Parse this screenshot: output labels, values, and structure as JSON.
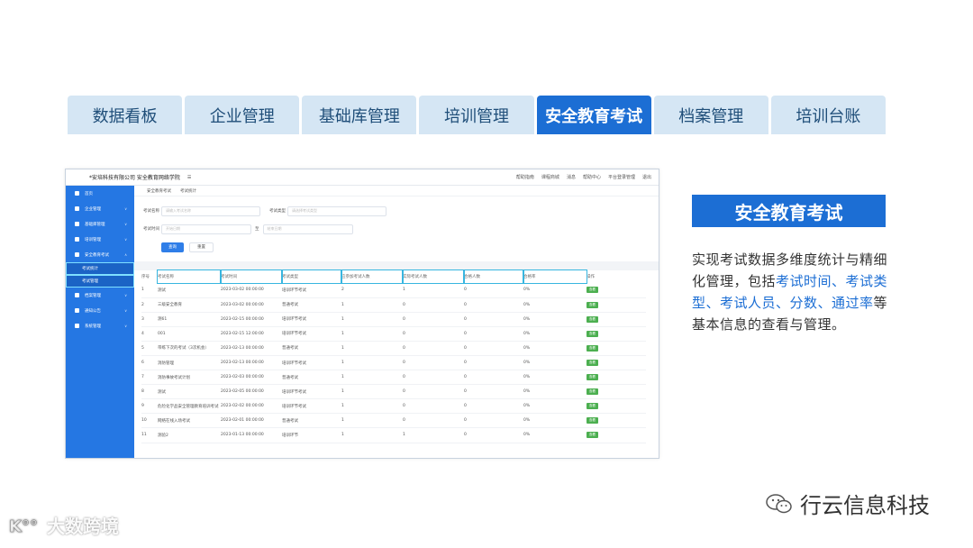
{
  "tabs": [
    "数据看板",
    "企业管理",
    "基础库管理",
    "培训管理",
    "安全教育考试",
    "档案管理",
    "培训台账"
  ],
  "active_tab_index": 4,
  "app": {
    "brand": "*安培科技有限公司 安全教育网络学院",
    "menu_icon": "menu-icon",
    "top_menu": [
      "帮助指南",
      "课程商城",
      "消息",
      "帮助中心",
      "平台登录管理",
      "退出"
    ]
  },
  "sidebar": {
    "items": [
      {
        "label": "首页",
        "icon": "home-icon"
      },
      {
        "label": "企业管理",
        "icon": "company-icon"
      },
      {
        "label": "基础库管理",
        "icon": "library-icon"
      },
      {
        "label": "培训管理",
        "icon": "training-icon"
      },
      {
        "label": "安全教育考试",
        "icon": "exam-icon"
      },
      {
        "label": "档案管理",
        "icon": "archive-icon"
      },
      {
        "label": "通知公告",
        "icon": "notice-icon"
      },
      {
        "label": "系统管理",
        "icon": "settings-icon"
      }
    ],
    "subitems": [
      "考试统计",
      "考试管理"
    ]
  },
  "crumb": [
    "安全教育考试",
    "考试统计"
  ],
  "form": {
    "exam_name_label": "考试名称",
    "exam_name_placeholder": "请输入考试名称",
    "exam_type_label": "考试类型",
    "exam_type_placeholder": "请选择考试类型",
    "exam_time_label": "考试时间",
    "start_placeholder": "开始日期",
    "to": "至",
    "end_placeholder": "结束日期",
    "search_btn": "查询",
    "reset_btn": "重置"
  },
  "table": {
    "headers": [
      "序号",
      "考试名称",
      "考试时间",
      "考试类型",
      "应参加考试人数",
      "实际考试人数",
      "合格人数",
      "合格率",
      "操作"
    ],
    "rows": [
      [
        "1",
        "测试",
        "2023-03-02 00:00:00",
        "培训环节考试",
        "2",
        "1",
        "0",
        "0%"
      ],
      [
        "2",
        "三级安全教育",
        "2023-03-02 00:00:00",
        "普通考试",
        "1",
        "0",
        "0",
        "0%"
      ],
      [
        "3",
        "测61",
        "2023-02-15 00:00:00",
        "培训环节考试",
        "1",
        "0",
        "0",
        "0%"
      ],
      [
        "4",
        "001",
        "2023-02-15 12:00:00",
        "培训环节考试",
        "1",
        "0",
        "0",
        "0%"
      ],
      [
        "5",
        "带练下次的考试（3次机会）",
        "2023-02-13 00:00:00",
        "普通考试",
        "1",
        "0",
        "0",
        "0%"
      ],
      [
        "6",
        "消防管理",
        "2023-02-13 00:00:00",
        "培训环节考试",
        "1",
        "0",
        "0",
        "0%"
      ],
      [
        "7",
        "消防事故考试计划",
        "2023-02-03 00:00:00",
        "普通考试",
        "1",
        "0",
        "0",
        "0%"
      ],
      [
        "8",
        "测试",
        "2023-02-05 00:00:00",
        "培训环节考试",
        "1",
        "0",
        "0",
        "0%"
      ],
      [
        "9",
        "危险化学品安全管理教育培训考试",
        "2023-02-02 00:00:00",
        "培训环节考试",
        "1",
        "0",
        "0",
        "0%"
      ],
      [
        "10",
        "网络在线入场考试",
        "2023-02-01 00:00:00",
        "普通考试",
        "1",
        "0",
        "0",
        "0%"
      ],
      [
        "11",
        "测验2",
        "2023-01-13 00:00:00",
        "培训环节",
        "1",
        "1",
        "0",
        "0%"
      ]
    ],
    "action_label": "查看"
  },
  "side_panel": {
    "title": "安全教育考试",
    "desc_parts": [
      {
        "text": "实现考试数据多维度统计与精细化管理，包括",
        "hl": false
      },
      {
        "text": "考试时间、考试类型、考试人员、分数、通过率",
        "hl": true
      },
      {
        "text": "等基本信息的查看与管理。",
        "hl": false
      }
    ]
  },
  "footer": {
    "brand": "行云信息科技",
    "watermark": "大数跨境"
  },
  "colors": {
    "accent": "#1c6ed4",
    "tab_bg": "#d5e6f4",
    "sidebar": "#2577e3",
    "success": "#4caf50"
  }
}
